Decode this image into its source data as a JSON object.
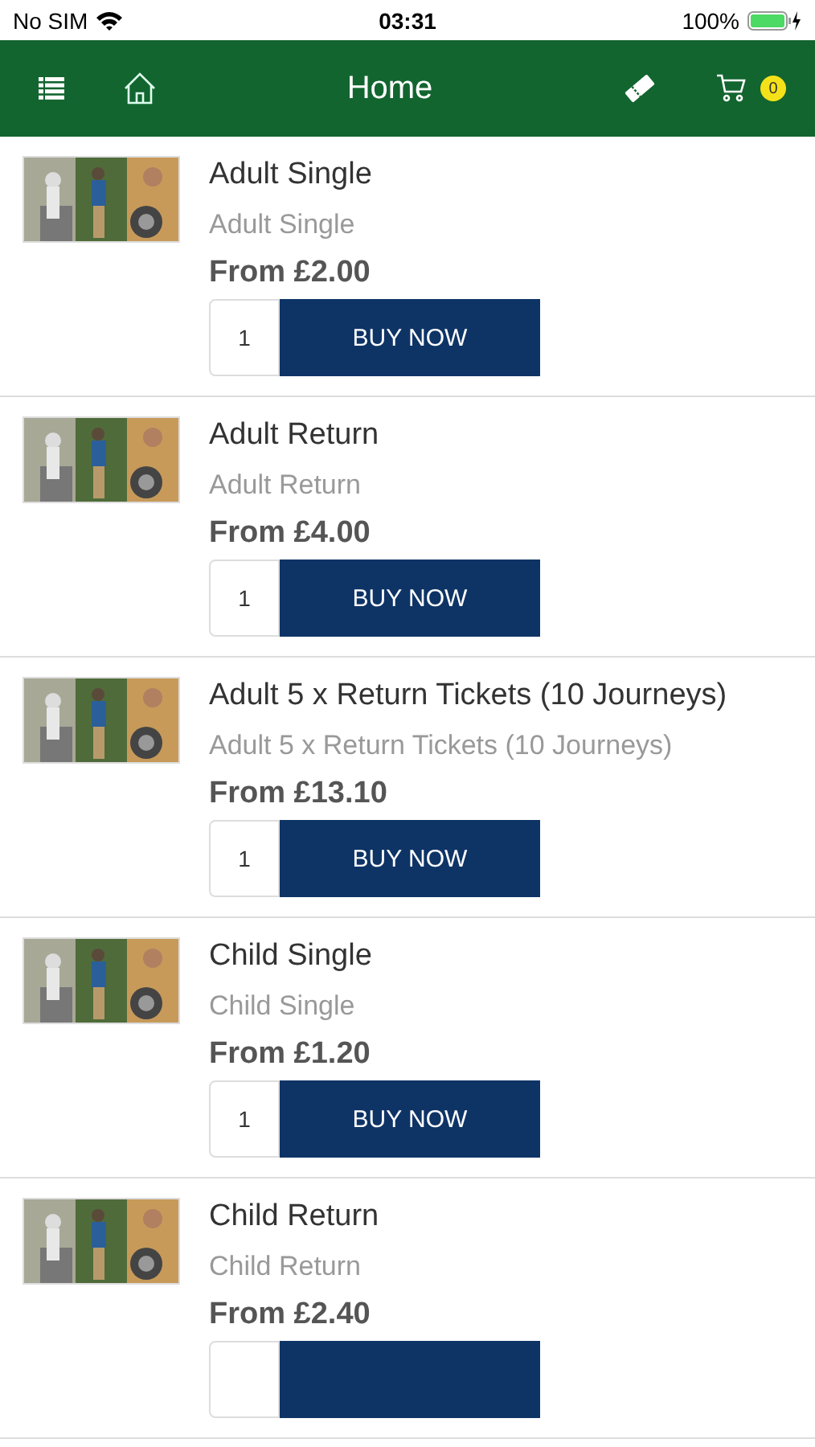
{
  "status_bar": {
    "carrier": "No SIM",
    "time": "03:31",
    "battery": "100%"
  },
  "header": {
    "title": "Home",
    "cart_count": "0"
  },
  "products": [
    {
      "title": "Adult Single",
      "subtitle": "Adult Single",
      "price": "From £2.00",
      "quantity": "1",
      "button": "BUY NOW"
    },
    {
      "title": "Adult Return",
      "subtitle": "Adult Return",
      "price": "From £4.00",
      "quantity": "1",
      "button": "BUY NOW"
    },
    {
      "title": "Adult 5 x Return Tickets (10 Journeys)",
      "subtitle": "Adult 5 x Return Tickets (10 Journeys)",
      "price": "From £13.10",
      "quantity": "1",
      "button": "BUY NOW"
    },
    {
      "title": "Child Single",
      "subtitle": "Child Single",
      "price": "From £1.20",
      "quantity": "1",
      "button": "BUY NOW"
    },
    {
      "title": "Child Return",
      "subtitle": "Child Return",
      "price": "From £2.40"
    }
  ]
}
